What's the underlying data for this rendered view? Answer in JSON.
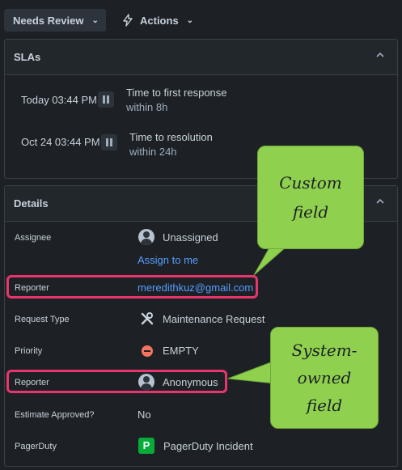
{
  "toolbar": {
    "status_label": "Needs Review",
    "actions_label": "Actions"
  },
  "sla": {
    "title": "SLAs",
    "items": [
      {
        "date": "Today 03:44 PM",
        "title": "Time to first response",
        "target": "within 8h"
      },
      {
        "date": "Oct 24 03:44 PM",
        "title": "Time to resolution",
        "target": "within 24h"
      }
    ]
  },
  "details": {
    "title": "Details",
    "fields": {
      "assignee": {
        "label": "Assignee",
        "value": "Unassigned",
        "action": "Assign to me"
      },
      "reporter_custom": {
        "label": "Reporter",
        "value": "meredithkuz@gmail.com"
      },
      "request_type": {
        "label": "Request Type",
        "value": "Maintenance Request",
        "icon": "tools-icon"
      },
      "priority": {
        "label": "Priority",
        "value": "EMPTY",
        "icon": "priority-blocked-icon"
      },
      "reporter_system": {
        "label": "Reporter",
        "value": "Anonymous",
        "icon": "avatar-icon"
      },
      "estimate_approved": {
        "label": "Estimate Approved?",
        "value": "No"
      },
      "pagerduty": {
        "label": "PagerDuty",
        "value": "PagerDuty Incident",
        "icon_letter": "P"
      }
    }
  },
  "annotations": {
    "custom": "Custom field",
    "custom_lines": [
      "Custom",
      "field"
    ],
    "system_lines": [
      "System-",
      "owned",
      "field"
    ],
    "highlight_color": "#e8356d",
    "callout_color": "#8fd14f"
  }
}
